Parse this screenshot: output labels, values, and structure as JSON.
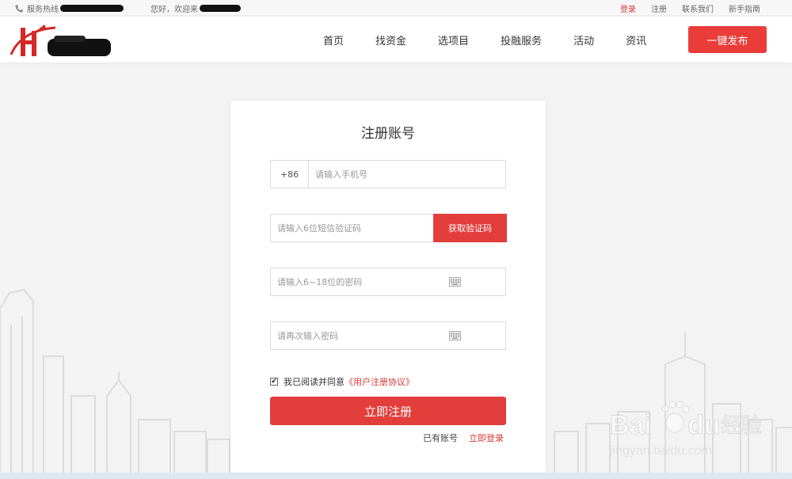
{
  "topbar": {
    "hotline_label": "服务热线",
    "welcome_label": "您好，欢迎来",
    "links": {
      "login": "登录",
      "register": "注册",
      "contact": "联系我们",
      "guide": "新手指南"
    }
  },
  "nav": {
    "items": [
      "首页",
      "找资金",
      "选项目",
      "投融服务",
      "活动",
      "资讯"
    ],
    "publish": "一键发布"
  },
  "form": {
    "title": "注册账号",
    "phone_prefix": "+86",
    "phone_placeholder": "请输入手机号",
    "sms_placeholder": "请输入6位短信验证码",
    "sms_button": "获取验证码",
    "password_placeholder": "请输入6~18位的密码",
    "confirm_placeholder": "请再次输入密码",
    "agree_text": "我已阅读并同意",
    "agree_terms": "《用户注册协议》",
    "agree_checked": true,
    "submit": "立即注册",
    "have_account": "已有账号",
    "login_now": "立即登录"
  },
  "watermark": {
    "brand": "Bai",
    "brand_cn": "经验",
    "url": "jingyan.baidu.com"
  },
  "colors": {
    "accent": "#e23e3b",
    "link": "#d63a36",
    "background": "#f3f3f4"
  }
}
